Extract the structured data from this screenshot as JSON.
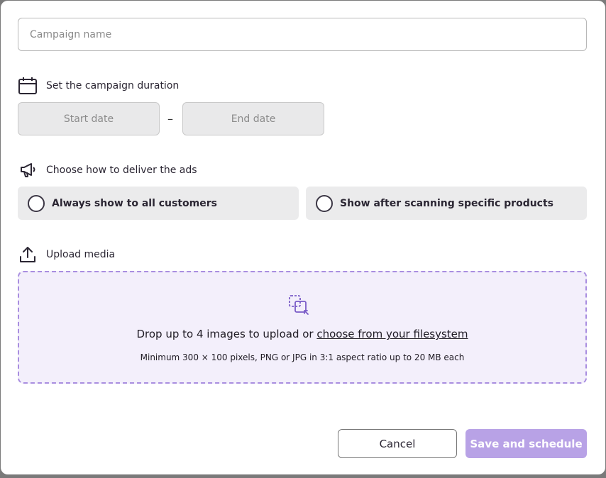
{
  "campaign": {
    "name_placeholder": "Campaign name",
    "name_value": ""
  },
  "duration": {
    "heading": "Set the campaign duration",
    "start_placeholder": "Start date",
    "separator": "–",
    "end_placeholder": "End date"
  },
  "delivery": {
    "heading": "Choose how to deliver the ads",
    "options": [
      {
        "label": "Always show to all customers",
        "selected": false
      },
      {
        "label": "Show after scanning specific products",
        "selected": false
      }
    ]
  },
  "upload": {
    "heading": "Upload media",
    "drop_text": "Drop up to 4 images to upload or ",
    "drop_link": "choose from your filesystem",
    "requirements": "Minimum 300 × 100 pixels, PNG or JPG in 3:1 aspect ratio up to 20 MB each"
  },
  "actions": {
    "cancel_label": "Cancel",
    "save_label": "Save and schedule"
  },
  "colors": {
    "accent": "#b8a2e6",
    "dropzone_border": "#a98ee0",
    "dropzone_bg": "#f3effb"
  },
  "icons": {
    "duration": "calendar-icon",
    "delivery": "megaphone-icon",
    "upload": "upload-icon",
    "dropzone": "select-image-icon"
  }
}
